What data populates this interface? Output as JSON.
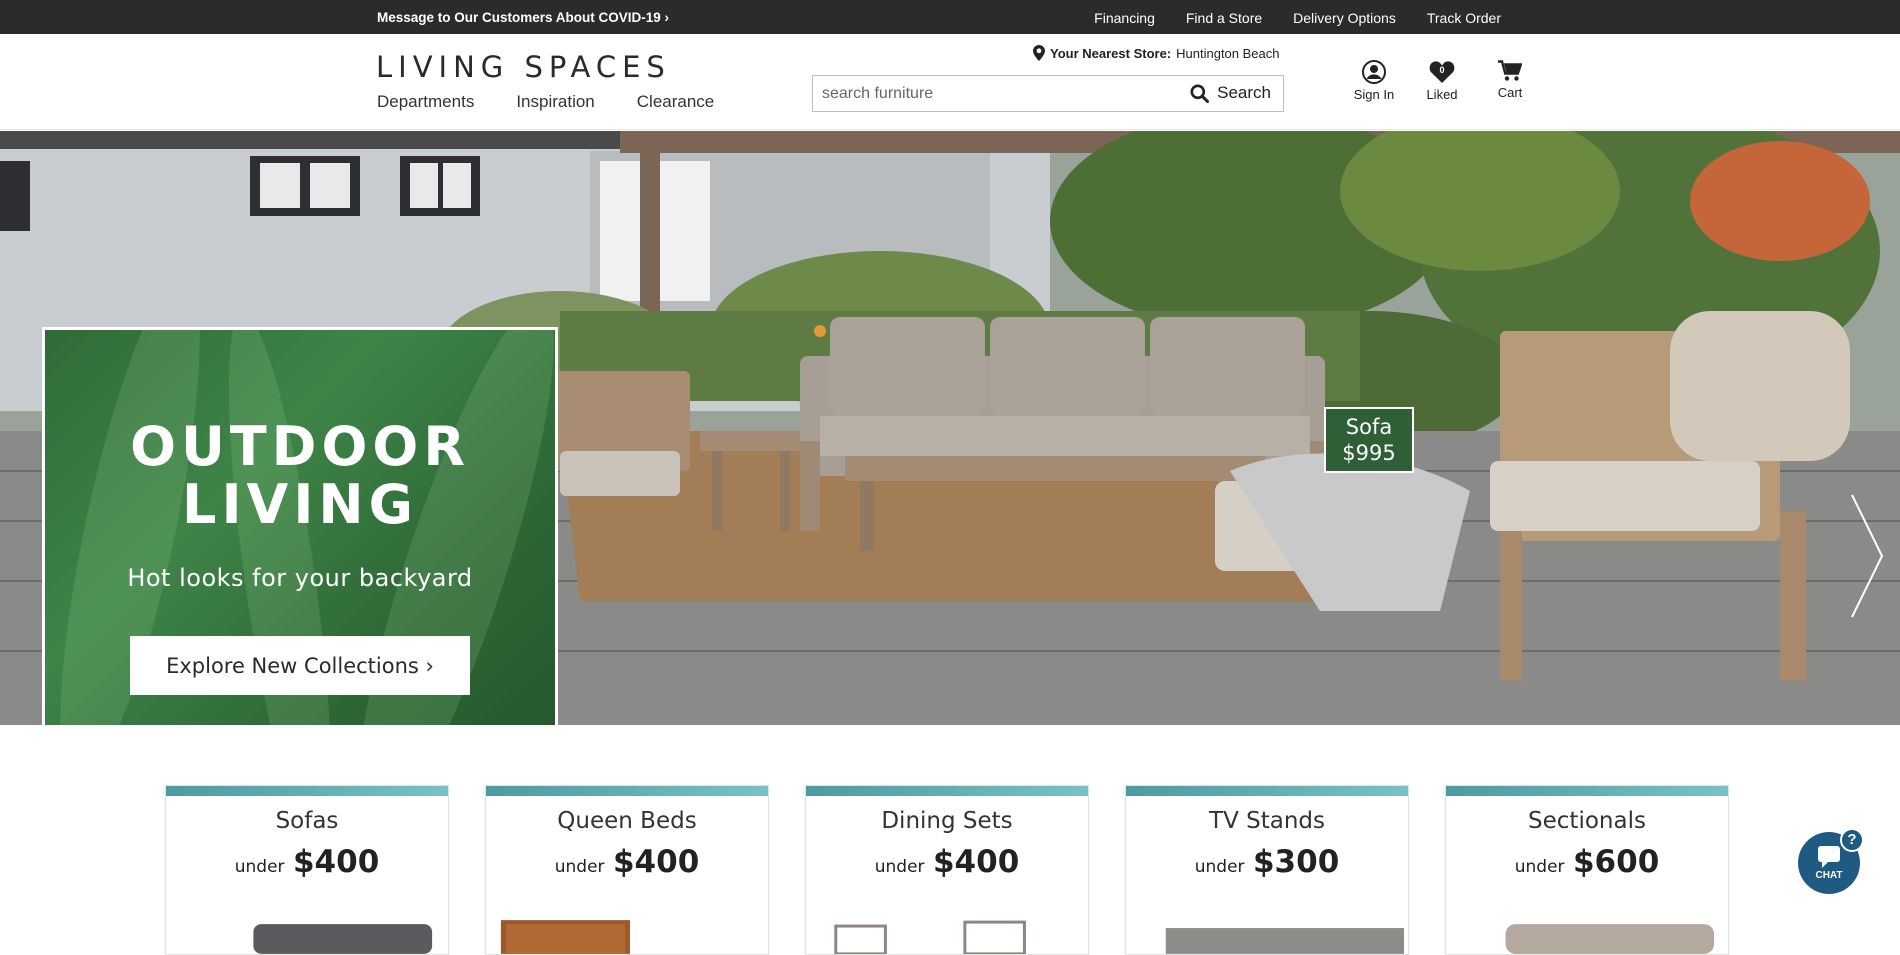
{
  "topbar": {
    "covid_message": "Message to Our Customers About COVID-19 ›",
    "links": [
      "Financing",
      "Find a Store",
      "Delivery Options",
      "Track Order"
    ]
  },
  "header": {
    "logo": "LIVING SPACES",
    "nav": [
      "Departments",
      "Inspiration",
      "Clearance"
    ],
    "store_label": "Your Nearest Store:",
    "store_name": "Huntington Beach",
    "search_placeholder": "search furniture",
    "search_button": "Search",
    "sign_in": "Sign In",
    "liked": "Liked",
    "liked_count": "0",
    "cart": "Cart"
  },
  "hero": {
    "headline_line1": "OUTDOOR",
    "headline_line2": "LIVING",
    "subhead": "Hot looks for your backyard",
    "cta": "Explore New Collections ›",
    "tag_item": "Sofa",
    "tag_price": "$995"
  },
  "categories": [
    {
      "title": "Sofas",
      "prefix": "under",
      "price": "$400"
    },
    {
      "title": "Queen Beds",
      "prefix": "under",
      "price": "$400"
    },
    {
      "title": "Dining Sets",
      "prefix": "under",
      "price": "$400"
    },
    {
      "title": "TV Stands",
      "prefix": "under",
      "price": "$300"
    },
    {
      "title": "Sectionals",
      "prefix": "under",
      "price": "$600"
    }
  ],
  "chat": {
    "label": "CHAT",
    "badge": "?"
  },
  "colors": {
    "topbar": "#2b2b2b",
    "promo_green": "#3e8447",
    "card_accent": "#5fb0b4",
    "chat_blue": "#1e5a82"
  }
}
